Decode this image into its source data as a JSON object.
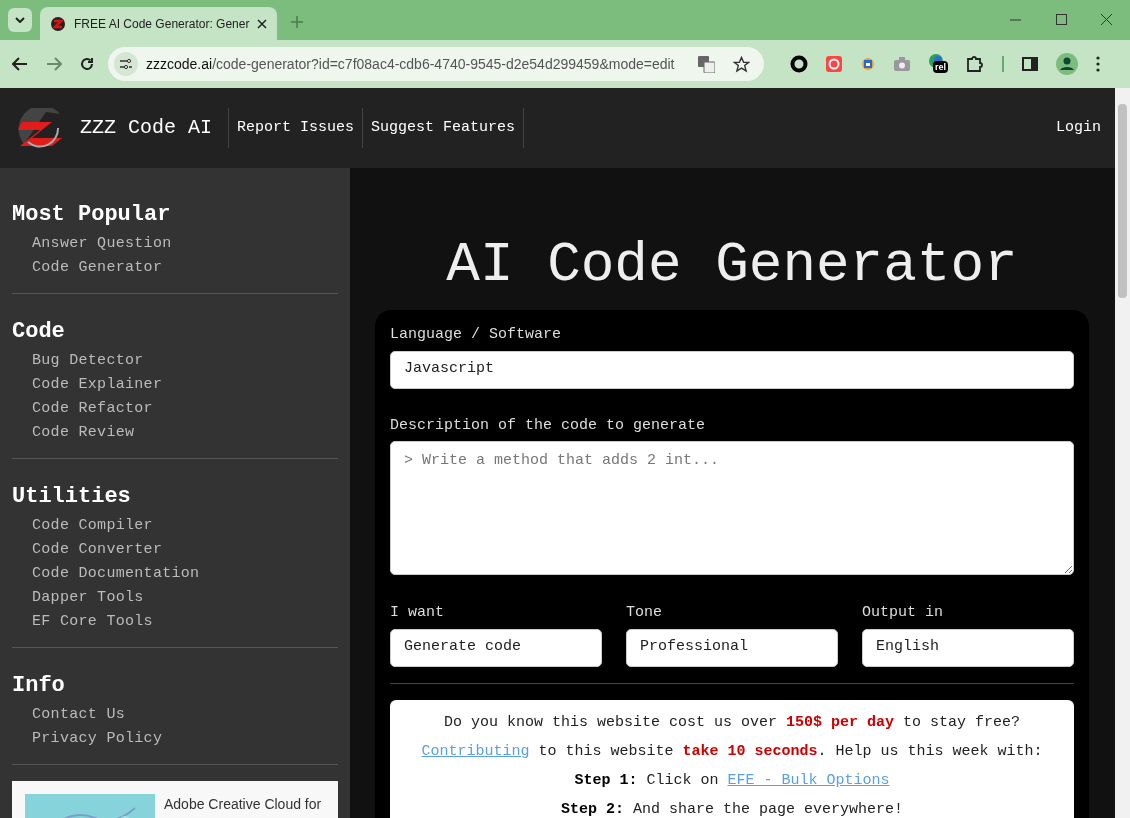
{
  "browser": {
    "tab_title": "FREE AI Code Generator: Gener",
    "url_host": "zzzcode.ai",
    "url_path": "/code-generator?id=c7f08ac4-cdb6-4740-9545-d2e54d299459&mode=edit",
    "extension_badge": "rel"
  },
  "header": {
    "brand": "ZZZ Code AI",
    "nav": [
      "Report Issues",
      "Suggest Features"
    ],
    "login": "Login"
  },
  "sidebar": [
    {
      "heading": "Most Popular",
      "items": [
        "Answer Question",
        "Code Generator"
      ]
    },
    {
      "heading": "Code",
      "items": [
        "Bug Detector",
        "Code Explainer",
        "Code Refactor",
        "Code Review"
      ]
    },
    {
      "heading": "Utilities",
      "items": [
        "Code Compiler",
        "Code Converter",
        "Code Documentation",
        "Dapper Tools",
        "EF Core Tools"
      ]
    },
    {
      "heading": "Info",
      "items": [
        "Contact Us",
        "Privacy Policy"
      ]
    }
  ],
  "ad": {
    "kind": "picture",
    "text": "Adobe Creative Cloud for"
  },
  "main": {
    "title": "AI Code Generator",
    "language": {
      "label": "Language / Software",
      "value": "Javascript"
    },
    "description": {
      "label": "Description of the code to generate",
      "placeholder": "> Write a method that adds 2 int..."
    },
    "options": [
      {
        "label": "I want",
        "value": "Generate code"
      },
      {
        "label": "Tone",
        "value": "Professional"
      },
      {
        "label": "Output in",
        "value": "English"
      }
    ],
    "notice": [
      {
        "kind": "alert",
        "parts": [
          {
            "kind": "text",
            "text": "Do you know this website cost us over **150$ per day** to stay free?"
          }
        ]
      },
      {
        "kind": "alert",
        "parts": [
          {
            "kind": "link",
            "text": "Contributing"
          },
          {
            "kind": "text",
            "text": " to this website **take 10 seconds**. Help us this week with:"
          }
        ]
      },
      {
        "kind": "step",
        "parts": [
          {
            "kind": "text",
            "text": "**Step 1:** Click on "
          },
          {
            "kind": "link",
            "text": "EFE - Bulk Options"
          }
        ]
      },
      {
        "kind": "step",
        "parts": [
          {
            "kind": "text",
            "text": "**Step 2:** And share the page everywhere!"
          }
        ]
      }
    ]
  }
}
